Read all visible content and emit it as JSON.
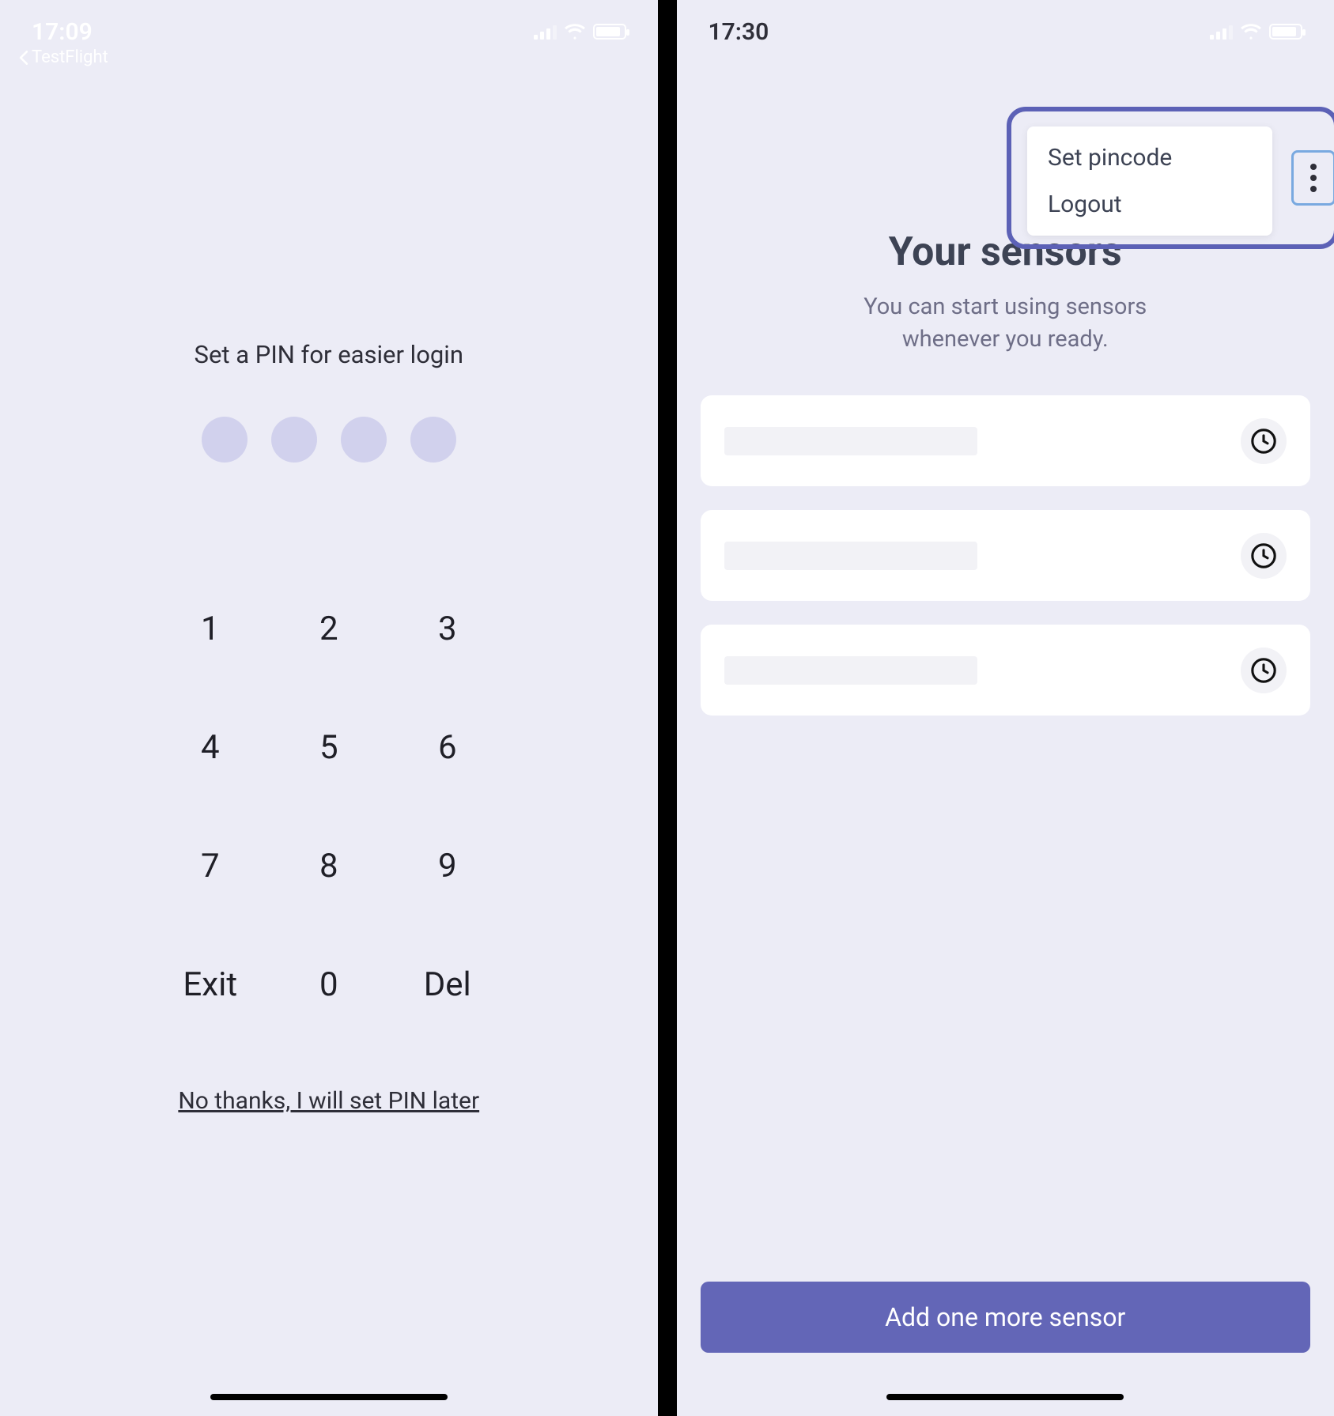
{
  "left": {
    "status": {
      "time": "17:09",
      "back_app": "TestFlight"
    },
    "pin": {
      "title": "Set a PIN for easier login",
      "keys": [
        "1",
        "2",
        "3",
        "4",
        "5",
        "6",
        "7",
        "8",
        "9",
        "Exit",
        "0",
        "Del"
      ],
      "skip": "No thanks, I will set PIN later"
    }
  },
  "right": {
    "status": {
      "time": "17:30"
    },
    "menu": {
      "items": [
        "Set pincode",
        "Logout"
      ]
    },
    "sensors": {
      "title": "Your sensors",
      "subtitle_line1": "You can start using sensors",
      "subtitle_line2": "whenever you ready."
    },
    "add_button": "Add one more sensor"
  }
}
